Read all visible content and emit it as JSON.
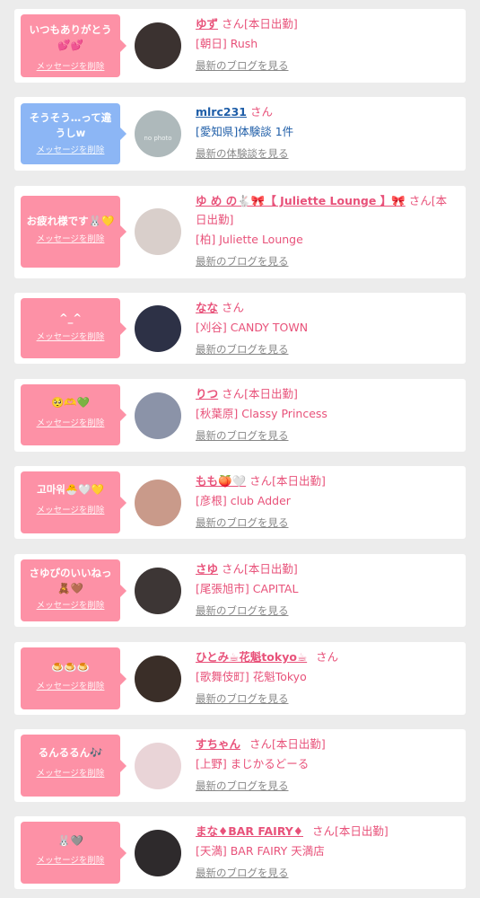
{
  "delete_label": "メッセージを削除",
  "san": "さん",
  "items": [
    {
      "message": "いつもありがとう💕💕",
      "name": "ゆず",
      "status": "[本日出勤]",
      "shop": "[朝日] Rush",
      "link": "最新のブログを見る",
      "bubble": "pink",
      "avatar_color": "#3b3230"
    },
    {
      "message": "そうそう…って違うしw",
      "name": "mlrc231",
      "status": "",
      "shop": "[愛知県]体験談 1件",
      "link": "最新の体験談を見る",
      "bubble": "blue",
      "avatar_color": "#aeb9bb",
      "avatar_text": "no photo"
    },
    {
      "message": "お疲れ様です🐰💛",
      "name": "ゆ め の🐇🎀【 Juliette Lounge 】🎀",
      "status": "[本日出勤]",
      "shop": "[柏] Juliette Lounge",
      "link": "最新のブログを見る",
      "bubble": "pink",
      "avatar_color": "#d9cfcb"
    },
    {
      "message": "^_^",
      "name": "なな",
      "status": "",
      "shop": "[刈谷] CANDY TOWN",
      "link": "最新のブログを見る",
      "bubble": "pink",
      "avatar_color": "#2d3146"
    },
    {
      "message": "🥺🫶💚",
      "name": "りつ",
      "status": "[本日出勤]",
      "shop": "[秋葉原] Classy Princess",
      "link": "最新のブログを見る",
      "bubble": "pink",
      "avatar_color": "#8b93a8"
    },
    {
      "message": "고마워🐣🤍💛",
      "name": "もも🍑🤍",
      "status": "[本日出勤]",
      "shop": "[彦根] club Adder",
      "link": "最新のブログを見る",
      "bubble": "pink",
      "avatar_color": "#c99a8a"
    },
    {
      "message": "さゆぴのいいねっ🧸🤎",
      "name": "さゆ",
      "status": "[本日出勤]",
      "shop": "[尾張旭市] CAPITAL",
      "link": "最新のブログを見る",
      "bubble": "pink",
      "avatar_color": "#3d3635"
    },
    {
      "message": "🍮🍮🍮",
      "name": "ひとみ☕花魁tokyo☕",
      "status": "",
      "shop": "[歌舞伎町] 花魁Tokyo",
      "link": "最新のブログを見る",
      "bubble": "pink",
      "avatar_color": "#3a2e28"
    },
    {
      "message": "るんるるん🎶",
      "name": "すちゃん",
      "status": "[本日出勤]",
      "shop": "[上野] まじかるどーる",
      "link": "最新のブログを見る",
      "bubble": "pink",
      "avatar_color": "#e9d4d7"
    },
    {
      "message": "🐰🩶",
      "name": "まな♦BAR FAIRY♦",
      "status": "[本日出勤]",
      "shop": "[天満] BAR FAIRY 天満店",
      "link": "最新のブログを見る",
      "bubble": "pink",
      "avatar_color": "#2e2a2c"
    }
  ]
}
